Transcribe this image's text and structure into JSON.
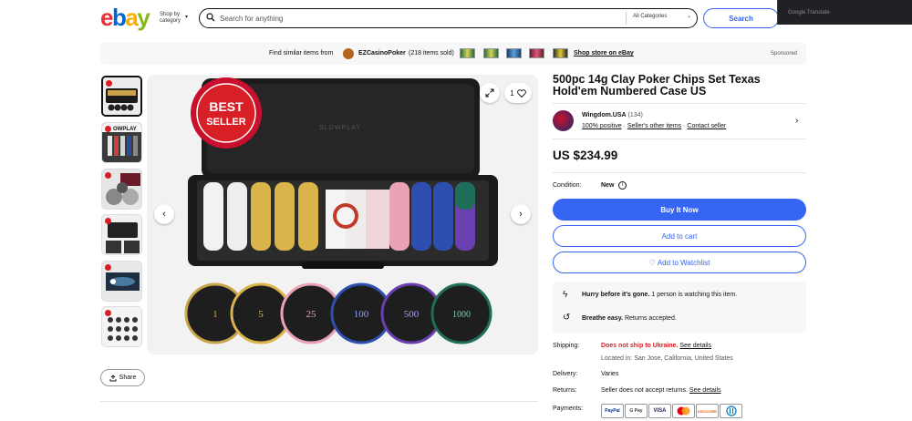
{
  "header": {
    "logo": {
      "e": "e",
      "b": "b",
      "a": "a",
      "y": "y"
    },
    "shop_by_line1": "Shop by",
    "shop_by_line2": "category",
    "search_placeholder": "Search for anything",
    "category_select": "All Categories",
    "search_button": "Search",
    "translate_label": "Google Translate"
  },
  "promo": {
    "text": "Find similar items from",
    "seller": "EZCasinoPoker",
    "items_sold": "(218 items sold)",
    "store_link": "Shop store on eBay",
    "sponsored": "Sponsored"
  },
  "gallery": {
    "image_alt": "500pc 14g Clay Poker Chips Set",
    "badge_line1": "BEST",
    "badge_line2": "SELLER",
    "case_brand": "SLOWPLAY",
    "chip_values": [
      "1",
      "5",
      "25",
      "100",
      "500",
      "1000"
    ],
    "count_indicator": "1",
    "share_label": "Share"
  },
  "listing": {
    "title": "500pc 14g Clay Poker Chips Set Texas Hold'em Numbered Case US",
    "seller_name": "Wingdom.USA",
    "seller_feedback_count": "(134)",
    "seller_positive": "100% positive",
    "seller_other_items": "Seller's other items",
    "contact_seller": "Contact seller",
    "price": "US $234.99",
    "condition_label": "Condition:",
    "condition_value": "New",
    "buy_now": "Buy It Now",
    "add_to_cart": "Add to cart",
    "add_to_watchlist": "Add to Watchlist",
    "urgency_title": "Hurry before it's gone.",
    "urgency_text": "1 person is watching this item.",
    "returns_title": "Breathe easy.",
    "returns_text": "Returns accepted.",
    "shipping_label": "Shipping:",
    "shipping_warning": "Does not ship to Ukraine.",
    "see_details": "See details",
    "located_in": "Located in: San Jose, California, United States",
    "delivery_label": "Delivery:",
    "delivery_value": "Varies",
    "returns_label": "Returns:",
    "returns_value": "Seller does not accept returns.",
    "returns_see_details": "See details",
    "payments_label": "Payments:",
    "payment_methods": [
      "PayPal",
      "G Pay",
      "VISA",
      "MC",
      "DISCOVER",
      "Diners"
    ]
  },
  "colors": {
    "ebay_red": "#e53238",
    "ebay_blue": "#0064d2",
    "ebay_yellow": "#f5af02",
    "ebay_green": "#86b817",
    "primary_blue": "#3665f3"
  }
}
